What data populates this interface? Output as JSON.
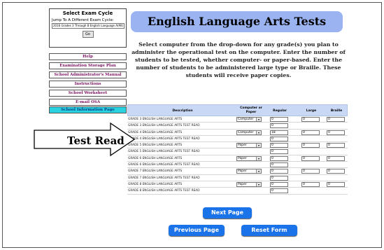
{
  "left_panel": {
    "exam_cycle_title": "Select Exam Cycle",
    "jump_label": "Jump To A Different Exam Cycle:",
    "exam_cycle_selected": "2016 Grades 3 Through 8 English Language A(Mt)",
    "go_label": "Go",
    "nav_items": [
      "Help",
      "Examination Storage Plan",
      "School Administrator's Manual",
      "Instructions",
      "School Worksheet",
      "E-mail OSA",
      "School Information Page"
    ]
  },
  "header": {
    "title": "English Language Arts Tests",
    "instructions": "Select computer from the drop-down for any grade(s) you plan to administer the operational test on the computer. Enter the number of students to be tested, whether computer- or paper-based. Enter the number of students to be administered large type or Braille. These students will receive paper copies."
  },
  "table": {
    "columns": [
      "Description",
      "Computer or Paper",
      "Regular",
      "Large",
      "Braille"
    ],
    "rows": [
      {
        "description": "GRADE 3 ENGLISH LANGUAGE ARTS",
        "mode": "Computer",
        "regular": "0",
        "large": "0",
        "braille": "0"
      },
      {
        "description": "GRADE 3 ENGLISH LANGUAGE ARTS TEST READ",
        "regular": "0"
      },
      {
        "description": "GRADE 4 ENGLISH LANGUAGE ARTS",
        "mode": "Computer",
        "regular": "18",
        "large": "0",
        "braille": "0"
      },
      {
        "description": "GRADE 4 ENGLISH LANGUAGE ARTS TEST READ",
        "regular": "0"
      },
      {
        "description": "GRADE 5 ENGLISH LANGUAGE ARTS",
        "mode": "Paper",
        "regular": "0",
        "large": "0",
        "braille": "0"
      },
      {
        "description": "GRADE 5 ENGLISH LANGUAGE ARTS TEST READ",
        "regular": "0"
      },
      {
        "description": "GRADE 6 ENGLISH LANGUAGE ARTS",
        "mode": "Paper",
        "regular": "0",
        "large": "0",
        "braille": "0"
      },
      {
        "description": "GRADE 6 ENGLISH LANGUAGE ARTS TEST READ",
        "regular": "0"
      },
      {
        "description": "GRADE 7 ENGLISH LANGUAGE ARTS",
        "mode": "Paper",
        "regular": "0",
        "large": "0",
        "braille": "0"
      },
      {
        "description": "GRADE 7 ENGLISH LANGUAGE ARTS TEST READ",
        "regular": "0"
      },
      {
        "description": "GRADE 8 ENGLISH LANGUAGE ARTS",
        "mode": "Paper",
        "regular": "0",
        "large": "0",
        "braille": "0"
      },
      {
        "description": "GRADE 8 ENGLISH LANGUAGE ARTS TEST READ",
        "regular": "0"
      }
    ]
  },
  "annotation": {
    "label": "Test Read"
  },
  "buttons": {
    "next": "Next Page",
    "previous": "Previous Page",
    "reset": "Reset Form"
  },
  "colors": {
    "banner": "#9bb3f1",
    "nav_text": "#7a1060",
    "nav_active": "#2ad2e0",
    "table_header": "#c9d8f4",
    "button": "#1a73e8"
  }
}
